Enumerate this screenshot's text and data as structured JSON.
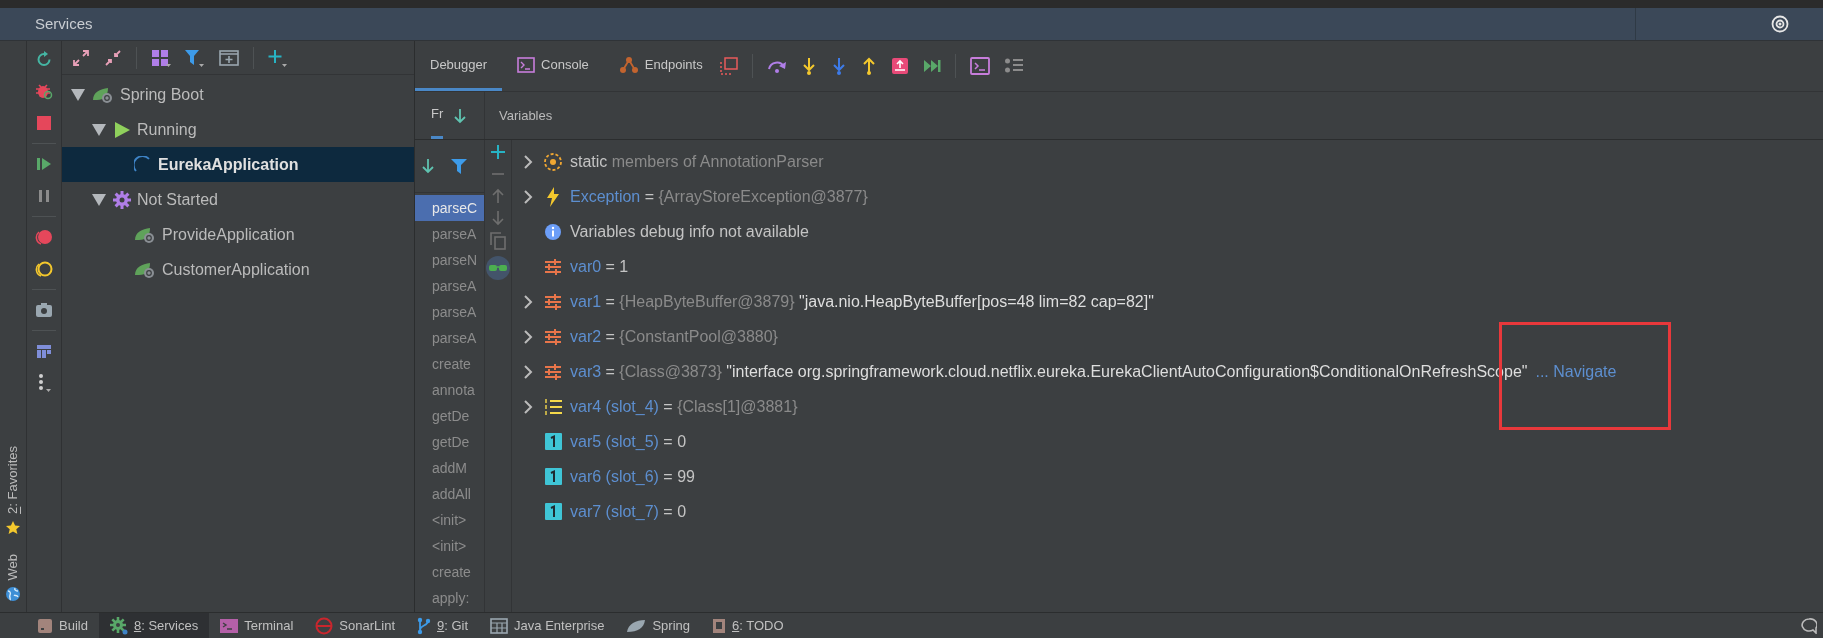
{
  "title_bar": {
    "title": "Services"
  },
  "side_strip": [
    {
      "label": "2: Favorites",
      "kind": "star",
      "mnemonic": true
    },
    {
      "label": "Web",
      "kind": "globe",
      "mnemonic": false
    }
  ],
  "tree": [
    {
      "label": "Spring Boot",
      "kind": "spring",
      "selected": false,
      "expanded": true,
      "children": [
        {
          "label": "Running",
          "kind": "run",
          "selected": false,
          "expanded": true,
          "children": [
            {
              "label": "EurekaApplication",
              "kind": "spinner",
              "selected": true
            }
          ]
        },
        {
          "label": "Not Started",
          "kind": "gear",
          "selected": false,
          "expanded": true,
          "children": [
            {
              "label": "ProvideApplication",
              "kind": "spring",
              "selected": false
            },
            {
              "label": "CustomerApplication",
              "kind": "spring",
              "selected": false
            }
          ]
        }
      ]
    }
  ],
  "debugger": {
    "tabs": [
      {
        "label": "Debugger",
        "kind": "plain",
        "selected": true
      },
      {
        "label": "Console",
        "kind": "console",
        "selected": false
      },
      {
        "label": "Endpoints",
        "kind": "endpoints",
        "selected": false
      }
    ],
    "frames_tab": {
      "label": "Fr",
      "selected": true
    },
    "variables_label": "Variables",
    "frames": [
      {
        "label": "parseC",
        "selected": true
      },
      {
        "label": "parseA",
        "selected": false
      },
      {
        "label": "parseN",
        "selected": false
      },
      {
        "label": "parseA",
        "selected": false
      },
      {
        "label": "parseA",
        "selected": false
      },
      {
        "label": "parseA",
        "selected": false
      },
      {
        "label": "create",
        "selected": false
      },
      {
        "label": "annota",
        "selected": false
      },
      {
        "label": "getDe",
        "selected": false
      },
      {
        "label": "getDe",
        "selected": false
      },
      {
        "label": "addM",
        "selected": false
      },
      {
        "label": "addAll",
        "selected": false
      },
      {
        "label": "<init>",
        "selected": false
      },
      {
        "label": "<init>",
        "selected": false
      },
      {
        "label": "create",
        "selected": false
      },
      {
        "label": "apply:",
        "selected": false
      }
    ],
    "variables": [
      {
        "kind": "static",
        "expandable": true,
        "parts": [
          {
            "text": "static",
            "kind": "plain"
          },
          {
            "text": " members of AnnotationParser",
            "kind": "dim"
          }
        ]
      },
      {
        "kind": "exception",
        "expandable": true,
        "parts": [
          {
            "text": "Exception",
            "kind": "name"
          },
          {
            "text": " = ",
            "kind": "plain"
          },
          {
            "text": "{ArrayStoreException@3877}",
            "kind": "dim"
          }
        ]
      },
      {
        "kind": "info",
        "expandable": false,
        "parts": [
          {
            "text": "Variables debug info not available",
            "kind": "plain"
          }
        ]
      },
      {
        "kind": "field",
        "expandable": false,
        "parts": [
          {
            "text": "var0",
            "kind": "name"
          },
          {
            "text": " = 1",
            "kind": "plain"
          }
        ]
      },
      {
        "kind": "field",
        "expandable": true,
        "parts": [
          {
            "text": "var1",
            "kind": "name"
          },
          {
            "text": " = ",
            "kind": "plain"
          },
          {
            "text": "{HeapByteBuffer@3879}",
            "kind": "dim"
          },
          {
            "text": " \"java.nio.HeapByteBuffer[pos=48 lim=82 cap=82]\"",
            "kind": "string"
          }
        ]
      },
      {
        "kind": "field",
        "expandable": true,
        "parts": [
          {
            "text": "var2",
            "kind": "name"
          },
          {
            "text": " = ",
            "kind": "plain"
          },
          {
            "text": "{ConstantPool@3880}",
            "kind": "dim"
          }
        ]
      },
      {
        "kind": "field",
        "expandable": true,
        "parts": [
          {
            "text": "var3",
            "kind": "name"
          },
          {
            "text": " = ",
            "kind": "plain"
          },
          {
            "text": "{Class@3873}",
            "kind": "dim"
          },
          {
            "text": " \"interface org.springframework.cloud.netflix.eureka.EurekaClientAutoConfiguration$ConditionalOnRefreshScope\"",
            "kind": "string"
          }
        ],
        "link": "... Navigate"
      },
      {
        "kind": "array",
        "expandable": true,
        "parts": [
          {
            "text": "var4 (slot_4)",
            "kind": "name"
          },
          {
            "text": " = ",
            "kind": "plain"
          },
          {
            "text": "{Class[1]@3881}",
            "kind": "dim"
          }
        ]
      },
      {
        "kind": "primitive",
        "expandable": false,
        "parts": [
          {
            "text": "var5 (slot_5)",
            "kind": "name"
          },
          {
            "text": " = 0",
            "kind": "plain"
          }
        ]
      },
      {
        "kind": "primitive",
        "expandable": false,
        "parts": [
          {
            "text": "var6 (slot_6)",
            "kind": "name"
          },
          {
            "text": " = 99",
            "kind": "plain"
          }
        ]
      },
      {
        "kind": "primitive",
        "expandable": false,
        "parts": [
          {
            "text": "var7 (slot_7)",
            "kind": "name"
          },
          {
            "text": " = 0",
            "kind": "plain"
          }
        ]
      }
    ]
  },
  "bottom_bar": [
    {
      "label": "Build",
      "kind": "build",
      "selected": false,
      "mnemonic": false
    },
    {
      "label": "8: Services",
      "kind": "services",
      "selected": true,
      "mnemonic": true
    },
    {
      "label": "Terminal",
      "kind": "terminal",
      "selected": false,
      "mnemonic": false
    },
    {
      "label": "SonarLint",
      "kind": "sonar",
      "selected": false,
      "mnemonic": false
    },
    {
      "label": "9: Git",
      "kind": "git",
      "selected": false,
      "mnemonic": true
    },
    {
      "label": "Java Enterprise",
      "kind": "javaee",
      "selected": false,
      "mnemonic": false
    },
    {
      "label": "Spring",
      "kind": "spring",
      "selected": false,
      "mnemonic": false
    },
    {
      "label": "6: TODO",
      "kind": "todo",
      "selected": false,
      "mnemonic": true
    }
  ]
}
